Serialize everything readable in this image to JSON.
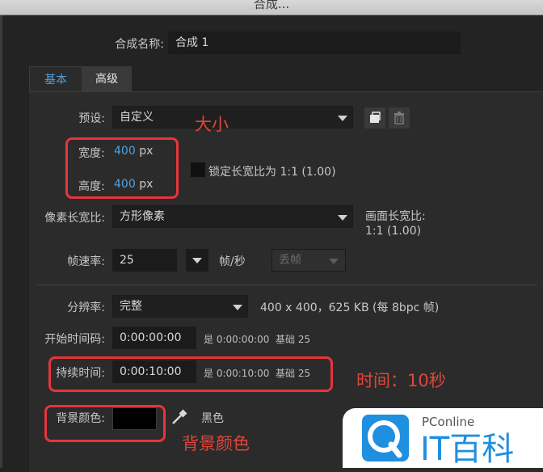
{
  "window": {
    "title": "合成..."
  },
  "comp_name": {
    "label": "合成名称:",
    "value": "合成 1"
  },
  "tabs": [
    {
      "label": "基本",
      "active": true
    },
    {
      "label": "高级",
      "active": false
    }
  ],
  "preset": {
    "label": "预设:",
    "value": "自定义"
  },
  "width": {
    "label": "宽度:",
    "value": "400",
    "unit": "px"
  },
  "height": {
    "label": "高度:",
    "value": "400",
    "unit": "px"
  },
  "lock_aspect": {
    "label": "锁定长宽比为 1:1 (1.00)",
    "checked": false
  },
  "pixel_aspect": {
    "label": "像素长宽比:",
    "value": "方形像素"
  },
  "frame_aspect": {
    "label": "画面长宽比:",
    "value": "1:1 (1.00)"
  },
  "frame_rate": {
    "label": "帧速率:",
    "value": "25",
    "unit": "帧/秒",
    "drop_frame": "丢帧"
  },
  "resolution": {
    "label": "分辨率:",
    "value": "完整",
    "info": "400 x 400，625 KB (每 8bpc 帧)"
  },
  "start_timecode": {
    "label": "开始时间码:",
    "value": "0:00:00:00",
    "info_prefix": "是 0:00:00:00",
    "info_base": "基础 25"
  },
  "duration": {
    "label": "持续时间:",
    "value": "0:00:10:00",
    "info_prefix": "是 0:00:10:00",
    "info_base": "基础 25"
  },
  "bg_color": {
    "label": "背景颜色:",
    "color": "#000000",
    "name": "黑色"
  },
  "annotations": {
    "size": "大小",
    "time": "时间：10秒",
    "bg": "背景颜色"
  },
  "watermark": {
    "brand_top": "PConline",
    "brand_main": "IT百科"
  },
  "colors": {
    "accent": "#4fa0e0",
    "annotation": "#e8343c",
    "panel": "#2b2b2b"
  }
}
